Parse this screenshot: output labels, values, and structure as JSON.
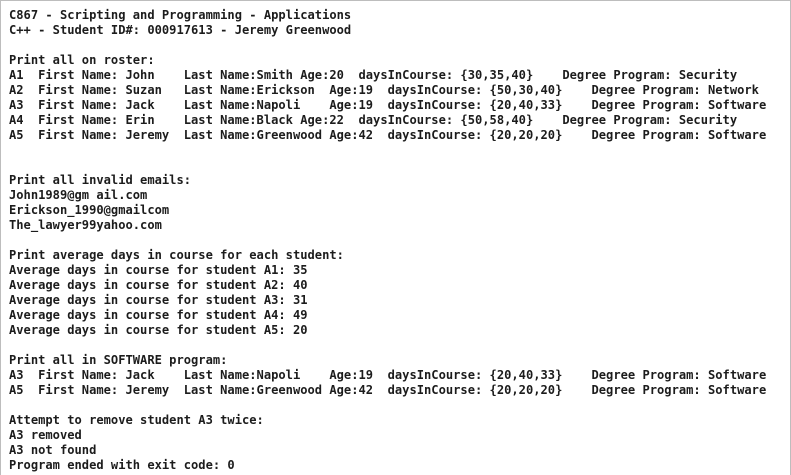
{
  "console": {
    "header": [
      "C867 - Scripting and Programming - Applications",
      "C++ - Student ID#: 000917613 - Jeremy Greenwood"
    ],
    "roster": {
      "heading": "Print all on roster:",
      "rows": [
        "A1  First Name: John    Last Name:Smith Age:20  daysInCourse: {30,35,40}    Degree Program: Security",
        "A2  First Name: Suzan   Last Name:Erickson  Age:19  daysInCourse: {50,30,40}    Degree Program: Network",
        "A3  First Name: Jack    Last Name:Napoli    Age:19  daysInCourse: {20,40,33}    Degree Program: Software",
        "A4  First Name: Erin    Last Name:Black Age:22  daysInCourse: {50,58,40}    Degree Program: Security",
        "A5  First Name: Jeremy  Last Name:Greenwood Age:42  daysInCourse: {20,20,20}    Degree Program: Software"
      ]
    },
    "invalid_emails": {
      "heading": "Print all invalid emails:",
      "rows": [
        "John1989@gm ail.com",
        "Erickson_1990@gmailcom",
        "The_lawyer99yahoo.com"
      ]
    },
    "average_days": {
      "heading": "Print average days in course for each student:",
      "rows": [
        "Average days in course for student A1: 35",
        "Average days in course for student A2: 40",
        "Average days in course for student A3: 31",
        "Average days in course for student A4: 49",
        "Average days in course for student A5: 20"
      ]
    },
    "software_program": {
      "heading": "Print all in SOFTWARE program:",
      "rows": [
        "A3  First Name: Jack    Last Name:Napoli    Age:19  daysInCourse: {20,40,33}    Degree Program: Software",
        "A5  First Name: Jeremy  Last Name:Greenwood Age:42  daysInCourse: {20,20,20}    Degree Program: Software"
      ]
    },
    "remove": {
      "heading": "Attempt to remove student A3 twice:",
      "rows": [
        "A3 removed",
        "A3 not found"
      ]
    },
    "exit_message": "Program ended with exit code: 0"
  }
}
